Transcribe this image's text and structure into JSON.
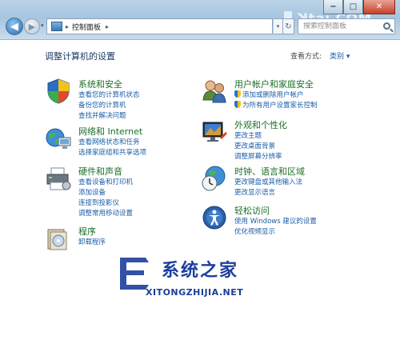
{
  "window": {
    "minimize": "−",
    "maximize": "□",
    "close": "✕"
  },
  "nav": {
    "back": "◀",
    "forward": "▶",
    "history_dropdown": "▾"
  },
  "address": {
    "separator": "▸",
    "path": "控制面板",
    "arrow": "▸",
    "dropdown": "▾",
    "refresh": "↻"
  },
  "search": {
    "placeholder": "搜索控制面板"
  },
  "corner_brand": "ꓘtaj.COM",
  "page": {
    "title": "调整计算机的设置",
    "view_label": "查看方式:",
    "view_value": "类别 ▾"
  },
  "categories": [
    {
      "title": "系统和安全",
      "icon": "shield-icon",
      "links": [
        "查看您的计算机状态",
        "备份您的计算机",
        "查找并解决问题"
      ]
    },
    {
      "title": "网络和 Internet",
      "icon": "network-globe-icon",
      "links": [
        "查看网络状态和任务",
        "选择家庭组和共享选项"
      ]
    },
    {
      "title": "硬件和声音",
      "icon": "printer-icon",
      "links": [
        "查看设备和打印机",
        "添加设备",
        "连接到投影仪",
        "调整常用移动设置"
      ]
    },
    {
      "title": "程序",
      "icon": "programs-icon",
      "links": [
        "卸载程序"
      ]
    },
    {
      "title": "用户帐户和家庭安全",
      "icon": "users-icon",
      "links": [
        "添加或删除用户帐户",
        "为所有用户设置家长控制"
      ]
    },
    {
      "title": "外观和个性化",
      "icon": "monitor-icon",
      "links": [
        "更改主题",
        "更改桌面背景",
        "调整屏幕分辨率"
      ]
    },
    {
      "title": "时钟、语言和区域",
      "icon": "clock-globe-icon",
      "links": [
        "更改键盘或其他输入法",
        "更改显示语言"
      ]
    },
    {
      "title": "轻松访问",
      "icon": "accessibility-icon",
      "links": [
        "使用 Windows 建议的设置",
        "优化视频显示"
      ]
    }
  ],
  "watermark": {
    "title": "系统之家",
    "subtitle": "XITONGZHIJIA.NET"
  },
  "colors": {
    "link": "#1a5ea8",
    "category_title": "#1b6e28",
    "page_title": "#1e3a64"
  }
}
